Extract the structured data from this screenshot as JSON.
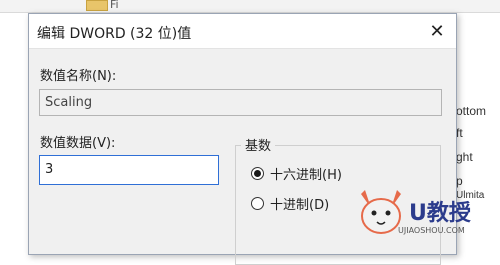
{
  "background": {
    "folder_label": "Fi",
    "right_fragments": [
      "ottom",
      "ft",
      "ght",
      "p",
      "Ulmita"
    ]
  },
  "dialog": {
    "title": "编辑 DWORD (32 位)值",
    "close_glyph": "✕",
    "name_label": "数值名称(N):",
    "name_value": "Scaling",
    "data_label": "数值数据(V):",
    "data_value": "3",
    "base_group": {
      "title": "基数",
      "options": [
        {
          "label": "十六进制(H)",
          "checked": true
        },
        {
          "label": "十进制(D)",
          "checked": false
        }
      ]
    }
  },
  "watermark": {
    "text": "U教授",
    "url": "UJIAOSHOU.COM"
  }
}
